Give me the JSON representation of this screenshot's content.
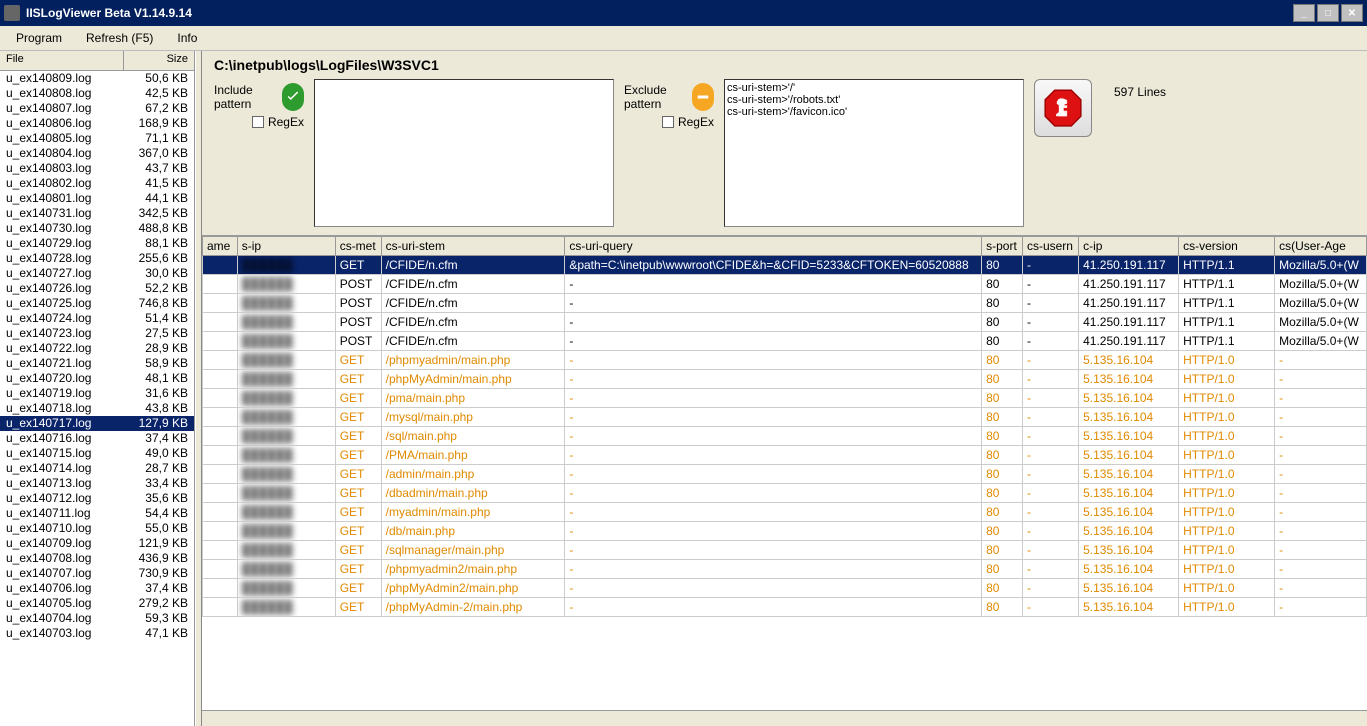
{
  "window": {
    "title": "IISLogViewer Beta V1.14.9.14"
  },
  "menu": {
    "program": "Program",
    "refresh": "Refresh (F5)",
    "info": "Info"
  },
  "file_list": {
    "header_file": "File",
    "header_size": "Size",
    "selected": "u_ex140717.log",
    "items": [
      {
        "name": "u_ex140809.log",
        "size": "50,6 KB"
      },
      {
        "name": "u_ex140808.log",
        "size": "42,5 KB"
      },
      {
        "name": "u_ex140807.log",
        "size": "67,2 KB"
      },
      {
        "name": "u_ex140806.log",
        "size": "168,9 KB"
      },
      {
        "name": "u_ex140805.log",
        "size": "71,1 KB"
      },
      {
        "name": "u_ex140804.log",
        "size": "367,0 KB"
      },
      {
        "name": "u_ex140803.log",
        "size": "43,7 KB"
      },
      {
        "name": "u_ex140802.log",
        "size": "41,5 KB"
      },
      {
        "name": "u_ex140801.log",
        "size": "44,1 KB"
      },
      {
        "name": "u_ex140731.log",
        "size": "342,5 KB"
      },
      {
        "name": "u_ex140730.log",
        "size": "488,8 KB"
      },
      {
        "name": "u_ex140729.log",
        "size": "88,1 KB"
      },
      {
        "name": "u_ex140728.log",
        "size": "255,6 KB"
      },
      {
        "name": "u_ex140727.log",
        "size": "30,0 KB"
      },
      {
        "name": "u_ex140726.log",
        "size": "52,2 KB"
      },
      {
        "name": "u_ex140725.log",
        "size": "746,8 KB"
      },
      {
        "name": "u_ex140724.log",
        "size": "51,4 KB"
      },
      {
        "name": "u_ex140723.log",
        "size": "27,5 KB"
      },
      {
        "name": "u_ex140722.log",
        "size": "28,9 KB"
      },
      {
        "name": "u_ex140721.log",
        "size": "58,9 KB"
      },
      {
        "name": "u_ex140720.log",
        "size": "48,1 KB"
      },
      {
        "name": "u_ex140719.log",
        "size": "31,6 KB"
      },
      {
        "name": "u_ex140718.log",
        "size": "43,8 KB"
      },
      {
        "name": "u_ex140717.log",
        "size": "127,9 KB"
      },
      {
        "name": "u_ex140716.log",
        "size": "37,4 KB"
      },
      {
        "name": "u_ex140715.log",
        "size": "49,0 KB"
      },
      {
        "name": "u_ex140714.log",
        "size": "28,7 KB"
      },
      {
        "name": "u_ex140713.log",
        "size": "33,4 KB"
      },
      {
        "name": "u_ex140712.log",
        "size": "35,6 KB"
      },
      {
        "name": "u_ex140711.log",
        "size": "54,4 KB"
      },
      {
        "name": "u_ex140710.log",
        "size": "55,0 KB"
      },
      {
        "name": "u_ex140709.log",
        "size": "121,9 KB"
      },
      {
        "name": "u_ex140708.log",
        "size": "436,9 KB"
      },
      {
        "name": "u_ex140707.log",
        "size": "730,9 KB"
      },
      {
        "name": "u_ex140706.log",
        "size": "37,4 KB"
      },
      {
        "name": "u_ex140705.log",
        "size": "279,2 KB"
      },
      {
        "name": "u_ex140704.log",
        "size": "59,3 KB"
      },
      {
        "name": "u_ex140703.log",
        "size": "47,1 KB"
      }
    ]
  },
  "path": "C:\\inetpub\\logs\\LogFiles\\W3SVC1",
  "filters": {
    "include_label": "Include pattern",
    "exclude_label": "Exclude pattern",
    "regex_label": "RegEx",
    "include_value": "",
    "exclude_value": "cs-uri-stem>'/'\ncs-uri-stem>'/robots.txt'\ncs-uri-stem>'/favicon.ico'"
  },
  "lines_count": "597 Lines",
  "grid": {
    "columns": [
      "ame",
      "s-ip",
      "cs-met",
      "cs-uri-stem",
      "cs-uri-query",
      "s-port",
      "cs-usern",
      "c-ip",
      "cs-version",
      "cs(User-Age"
    ],
    "rows": [
      {
        "sel": true,
        "orange": false,
        "sip": "██████",
        "met": "GET",
        "stem": "/CFIDE/n.cfm",
        "query": "&path=C:\\inetpub\\wwwroot\\CFIDE&h=&CFID=5233&CFTOKEN=60520888",
        "sport": "80",
        "user": "-",
        "cip": "41.250.191.117",
        "ver": "HTTP/1.1",
        "ua": "Mozilla/5.0+(W"
      },
      {
        "sel": false,
        "orange": false,
        "sip": "██████",
        "met": "POST",
        "stem": "/CFIDE/n.cfm",
        "query": "-",
        "sport": "80",
        "user": "-",
        "cip": "41.250.191.117",
        "ver": "HTTP/1.1",
        "ua": "Mozilla/5.0+(W"
      },
      {
        "sel": false,
        "orange": false,
        "sip": "██████",
        "met": "POST",
        "stem": "/CFIDE/n.cfm",
        "query": "-",
        "sport": "80",
        "user": "-",
        "cip": "41.250.191.117",
        "ver": "HTTP/1.1",
        "ua": "Mozilla/5.0+(W"
      },
      {
        "sel": false,
        "orange": false,
        "sip": "██████",
        "met": "POST",
        "stem": "/CFIDE/n.cfm",
        "query": "-",
        "sport": "80",
        "user": "-",
        "cip": "41.250.191.117",
        "ver": "HTTP/1.1",
        "ua": "Mozilla/5.0+(W"
      },
      {
        "sel": false,
        "orange": false,
        "sip": "██████",
        "met": "POST",
        "stem": "/CFIDE/n.cfm",
        "query": "-",
        "sport": "80",
        "user": "-",
        "cip": "41.250.191.117",
        "ver": "HTTP/1.1",
        "ua": "Mozilla/5.0+(W"
      },
      {
        "sel": false,
        "orange": true,
        "sip": "██████",
        "met": "GET",
        "stem": "/phpmyadmin/main.php",
        "query": "-",
        "sport": "80",
        "user": "-",
        "cip": "5.135.16.104",
        "ver": "HTTP/1.0",
        "ua": "-"
      },
      {
        "sel": false,
        "orange": true,
        "sip": "██████",
        "met": "GET",
        "stem": "/phpMyAdmin/main.php",
        "query": "-",
        "sport": "80",
        "user": "-",
        "cip": "5.135.16.104",
        "ver": "HTTP/1.0",
        "ua": "-"
      },
      {
        "sel": false,
        "orange": true,
        "sip": "██████",
        "met": "GET",
        "stem": "/pma/main.php",
        "query": "-",
        "sport": "80",
        "user": "-",
        "cip": "5.135.16.104",
        "ver": "HTTP/1.0",
        "ua": "-"
      },
      {
        "sel": false,
        "orange": true,
        "sip": "██████",
        "met": "GET",
        "stem": "/mysql/main.php",
        "query": "-",
        "sport": "80",
        "user": "-",
        "cip": "5.135.16.104",
        "ver": "HTTP/1.0",
        "ua": "-"
      },
      {
        "sel": false,
        "orange": true,
        "sip": "██████",
        "met": "GET",
        "stem": "/sql/main.php",
        "query": "-",
        "sport": "80",
        "user": "-",
        "cip": "5.135.16.104",
        "ver": "HTTP/1.0",
        "ua": "-"
      },
      {
        "sel": false,
        "orange": true,
        "sip": "██████",
        "met": "GET",
        "stem": "/PMA/main.php",
        "query": "-",
        "sport": "80",
        "user": "-",
        "cip": "5.135.16.104",
        "ver": "HTTP/1.0",
        "ua": "-"
      },
      {
        "sel": false,
        "orange": true,
        "sip": "██████",
        "met": "GET",
        "stem": "/admin/main.php",
        "query": "-",
        "sport": "80",
        "user": "-",
        "cip": "5.135.16.104",
        "ver": "HTTP/1.0",
        "ua": "-"
      },
      {
        "sel": false,
        "orange": true,
        "sip": "██████",
        "met": "GET",
        "stem": "/dbadmin/main.php",
        "query": "-",
        "sport": "80",
        "user": "-",
        "cip": "5.135.16.104",
        "ver": "HTTP/1.0",
        "ua": "-"
      },
      {
        "sel": false,
        "orange": true,
        "sip": "██████",
        "met": "GET",
        "stem": "/myadmin/main.php",
        "query": "-",
        "sport": "80",
        "user": "-",
        "cip": "5.135.16.104",
        "ver": "HTTP/1.0",
        "ua": "-"
      },
      {
        "sel": false,
        "orange": true,
        "sip": "██████",
        "met": "GET",
        "stem": "/db/main.php",
        "query": "-",
        "sport": "80",
        "user": "-",
        "cip": "5.135.16.104",
        "ver": "HTTP/1.0",
        "ua": "-"
      },
      {
        "sel": false,
        "orange": true,
        "sip": "██████",
        "met": "GET",
        "stem": "/sqlmanager/main.php",
        "query": "-",
        "sport": "80",
        "user": "-",
        "cip": "5.135.16.104",
        "ver": "HTTP/1.0",
        "ua": "-"
      },
      {
        "sel": false,
        "orange": true,
        "sip": "██████",
        "met": "GET",
        "stem": "/phpmyadmin2/main.php",
        "query": "-",
        "sport": "80",
        "user": "-",
        "cip": "5.135.16.104",
        "ver": "HTTP/1.0",
        "ua": "-"
      },
      {
        "sel": false,
        "orange": true,
        "sip": "██████",
        "met": "GET",
        "stem": "/phpMyAdmin2/main.php",
        "query": "-",
        "sport": "80",
        "user": "-",
        "cip": "5.135.16.104",
        "ver": "HTTP/1.0",
        "ua": "-"
      },
      {
        "sel": false,
        "orange": true,
        "sip": "██████",
        "met": "GET",
        "stem": "/phpMyAdmin-2/main.php",
        "query": "-",
        "sport": "80",
        "user": "-",
        "cip": "5.135.16.104",
        "ver": "HTTP/1.0",
        "ua": "-"
      }
    ]
  }
}
